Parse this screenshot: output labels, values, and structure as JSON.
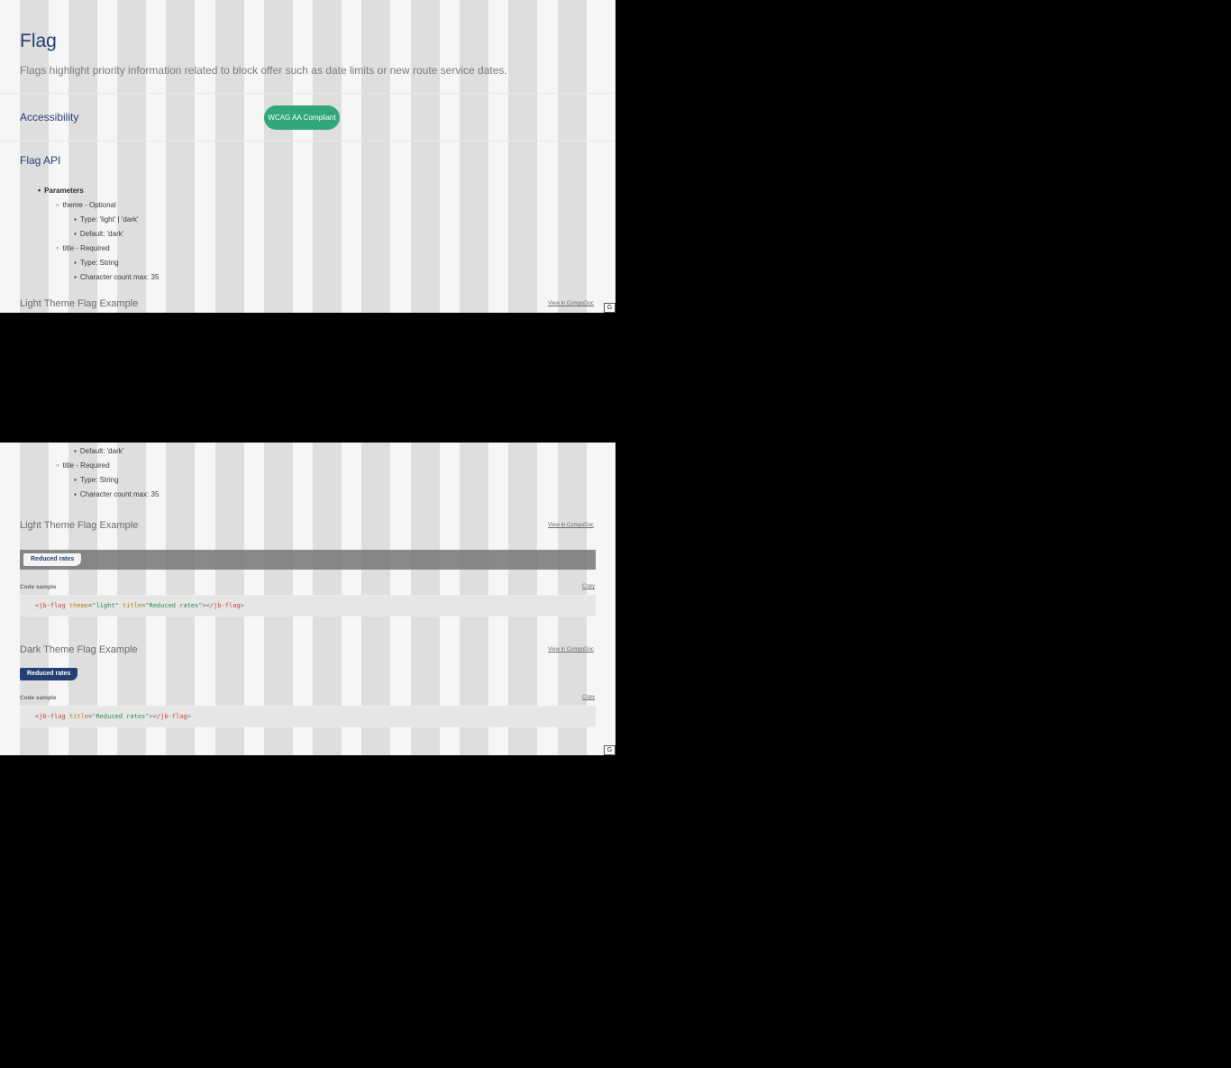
{
  "page": {
    "title": "Flag",
    "lead": "Flags highlight priority information related to block offer such as date limits or new route service dates."
  },
  "accessibility": {
    "heading": "Accessibility",
    "badge": "WCAG AA Compliant"
  },
  "api": {
    "heading": "Flag API",
    "parameters_label": "Parameters",
    "theme_label": "theme - Optional",
    "theme_type": "Type: 'light' | 'dark'",
    "theme_default": "Default: 'dark'",
    "title_label": "title - Required",
    "title_type": "Type: String",
    "title_max": "Character count max: 35"
  },
  "light_example": {
    "heading": "Light Theme Flag Example",
    "compodoc_link": "View in CompoDoc",
    "flag_text": "Reduced rates",
    "code_label": "Code sample",
    "copy_label": "Copy",
    "code": {
      "open_tag": "jb-flag",
      "attr1_name": "theme",
      "attr1_value": "\"light\"",
      "attr2_name": "title",
      "attr2_value": "\"Reduced rates\"",
      "close_tag": "jb-flag"
    }
  },
  "dark_example": {
    "heading": "Dark Theme Flag Example",
    "compodoc_link": "View in CompoDoc",
    "flag_text": "Reduced rates",
    "code_label": "Code sample",
    "copy_label": "Copy",
    "code": {
      "open_tag": "jb-flag",
      "attr1_name": "title",
      "attr1_value": "\"Reduced rates\"",
      "close_tag": "jb-flag"
    }
  },
  "grid_toggle_label": "G",
  "colors": {
    "heading": "#263f72",
    "badge": "#31a77a",
    "dark_flag": "#263f72"
  }
}
